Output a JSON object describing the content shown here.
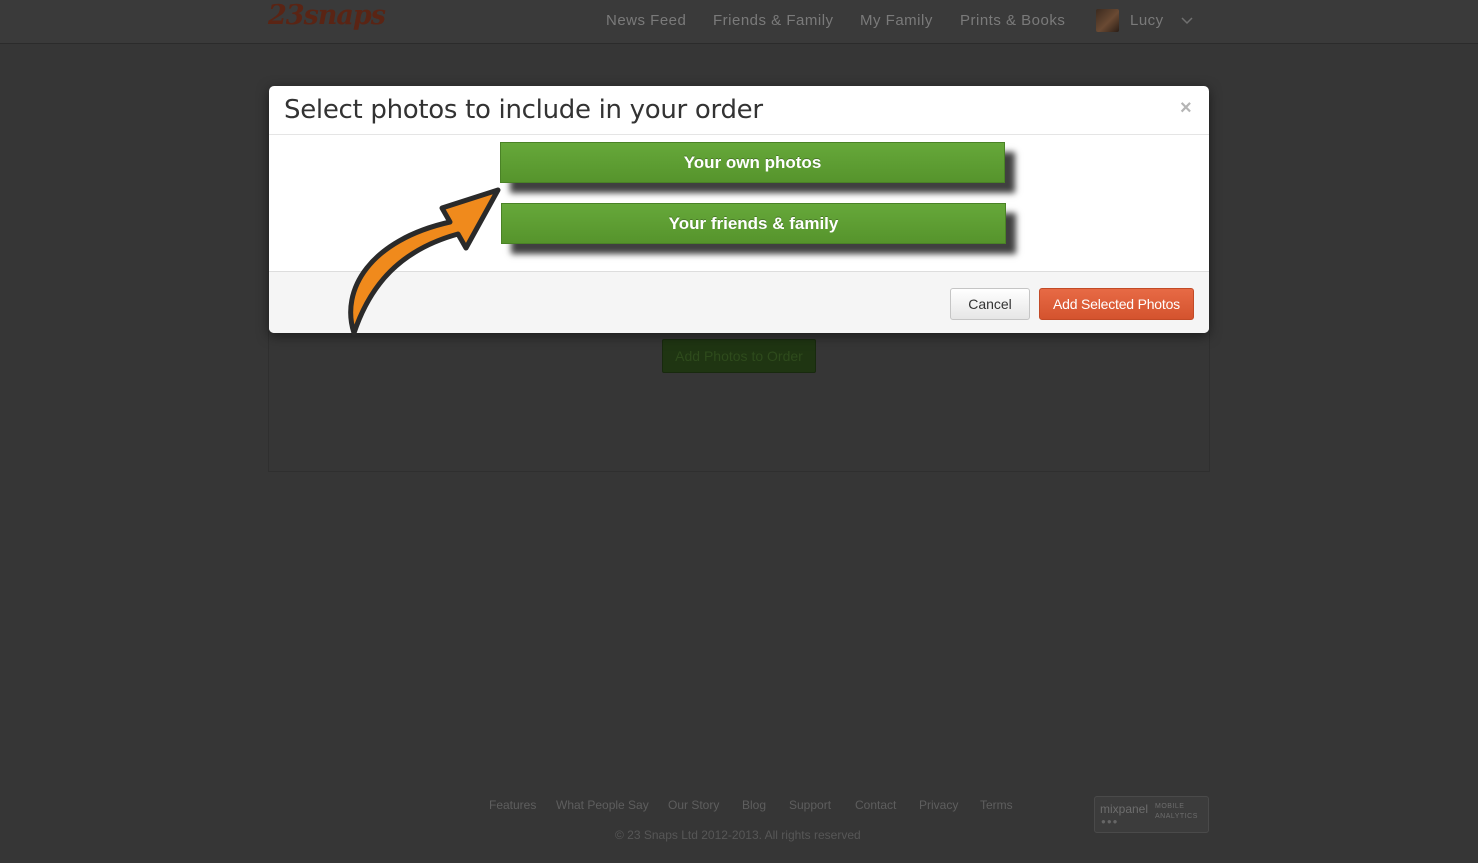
{
  "header": {
    "logo": "23snaps",
    "nav": [
      "News Feed",
      "Friends & Family",
      "My Family",
      "Prints & Books"
    ],
    "user_name": "Lucy"
  },
  "background": {
    "add_photos_button": "Add Photos to Order"
  },
  "modal": {
    "title": "Select photos to include in your order",
    "close": "×",
    "options": [
      "Your own photos",
      "Your friends & family"
    ],
    "cancel_label": "Cancel",
    "add_label": "Add Selected Photos"
  },
  "footer": {
    "links": [
      "Features",
      "What People Say",
      "Our Story",
      "Blog",
      "Support",
      "Contact",
      "Privacy",
      "Terms"
    ],
    "copyright": "© 23 Snaps Ltd 2012-2013. All rights reserved",
    "badge_name": "mixpanel",
    "badge_sub1": "MOBILE",
    "badge_sub2": "ANALYTICS"
  },
  "colors": {
    "overlay": "#363636",
    "green": "#5c9e31",
    "orange_button": "#e0603b",
    "arrow": "#f08a1c"
  }
}
